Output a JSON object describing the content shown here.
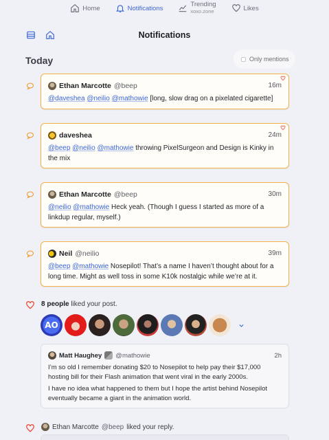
{
  "nav": {
    "home": "Home",
    "notifications": "Notifications",
    "trending": "Trending",
    "trending_sub": "xoxo.zone",
    "likes": "Likes"
  },
  "header": {
    "title": "Notifications"
  },
  "section": {
    "today": "Today",
    "only_mentions": "Only mentions"
  },
  "notifications": [
    {
      "name": "Ethan Marcotte",
      "handle": "@beep",
      "time": "16m",
      "mentions": [
        "@daveshea",
        "@neilio",
        "@mathowie"
      ],
      "text": "[long, slow drag on a pixelated cigarette]"
    },
    {
      "name": "daveshea",
      "handle": "",
      "time": "24m",
      "mentions": [
        "@beep",
        "@neilio",
        "@mathowie"
      ],
      "text": " throwing PixelSurgeon and Design is Kinky in the mix"
    },
    {
      "name": "Ethan Marcotte",
      "handle": "@beep",
      "time": "30m",
      "mentions": [
        "@neilio",
        "@mathowie"
      ],
      "text": "Heck yeah. (Though I guess I started as more of a linkdup regular, myself.)"
    },
    {
      "name": "Neil",
      "handle": "@neilio",
      "time": "39m",
      "mentions": [
        "@beep",
        "@mathowie"
      ],
      "text": "Nosepilot! That’s a name I haven’t thought about for a long time. Might as well toss in some K10k nostalgic while we’re at it."
    }
  ],
  "likes": {
    "count_label": "8 people",
    "rest": " liked your post.",
    "faces": [
      "AO",
      "",
      "",
      "",
      "",
      "",
      "",
      ""
    ]
  },
  "quoted_post": {
    "name": "Matt Haughey",
    "handle": "@mathowie",
    "time": "2h",
    "para1": "I’m so old I remember donating $20 to Nosepilot to help pay their $17,000 hosting bill for their Flash animation that went viral in the early 2000s.",
    "para2": "I have no idea what happened to them but I hope the artist behind Nosepilot eventually became a giant in the animation world."
  },
  "reply": {
    "name": "Ethan Marcotte",
    "handle": "@beep",
    "rest": " liked your reply."
  },
  "colors": {
    "accent": "#3a66d8",
    "card_border": "#f1b04a",
    "heart": "#e8553f",
    "bubble": "#f09a2e"
  }
}
